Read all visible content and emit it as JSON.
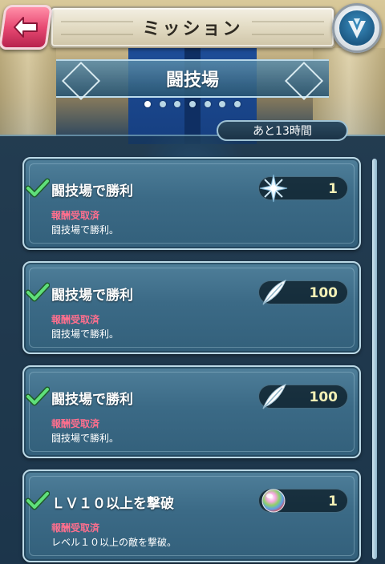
{
  "header": {
    "title": "ミッション",
    "back_icon": "back-arrow-icon",
    "emblem_icon": "feh-emblem-icon"
  },
  "category": {
    "label": "闘技場",
    "pages": 7,
    "active_page": 1
  },
  "timer": {
    "label": "あと13時間"
  },
  "missions": [
    {
      "title": "闘技場で勝利",
      "status": "報酬受取済",
      "description": "闘技場で勝利。",
      "reward_icon": "hero-merit-star-icon",
      "reward_qty": "1"
    },
    {
      "title": "闘技場で勝利",
      "status": "報酬受取済",
      "description": "闘技場で勝利。",
      "reward_icon": "feather-icon",
      "reward_qty": "100"
    },
    {
      "title": "闘技場で勝利",
      "status": "報酬受取済",
      "description": "闘技場で勝利。",
      "reward_icon": "feather-icon",
      "reward_qty": "100"
    },
    {
      "title": "ＬＶ１０以上を撃破",
      "status": "報酬受取済",
      "description": "レベル１０以上の敵を撃破。",
      "reward_icon": "orb-icon",
      "reward_qty": "1"
    }
  ],
  "colors": {
    "status_claimed": "#ff6f8e",
    "reward_qty": "#f3f0b6",
    "back_button": "#e84a73"
  }
}
